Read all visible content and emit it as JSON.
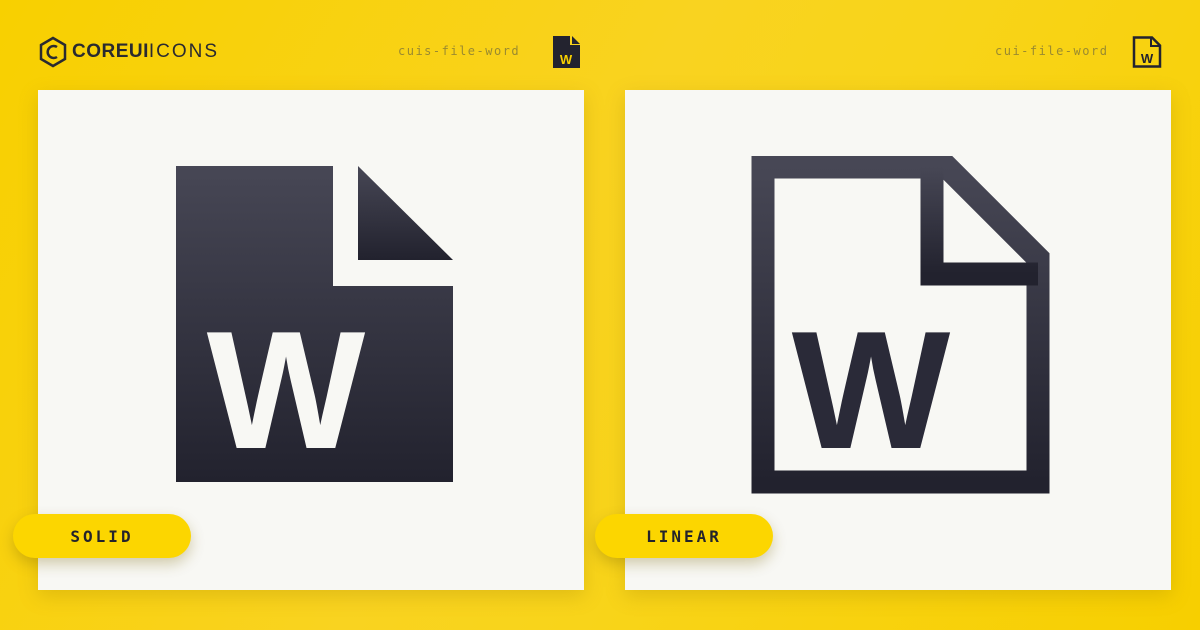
{
  "brand": {
    "bold": "COREUI",
    "light": "ICONS"
  },
  "solid": {
    "name": "cuis-file-word",
    "label": "SOLID",
    "icon": "file-word-solid-icon"
  },
  "linear": {
    "name": "cui-file-word",
    "label": "LINEAR",
    "icon": "file-word-linear-icon"
  },
  "colors": {
    "background": "#f8d000",
    "icon": "#2a2a36",
    "card": "#f8f8f4",
    "pill": "#fcd600"
  }
}
